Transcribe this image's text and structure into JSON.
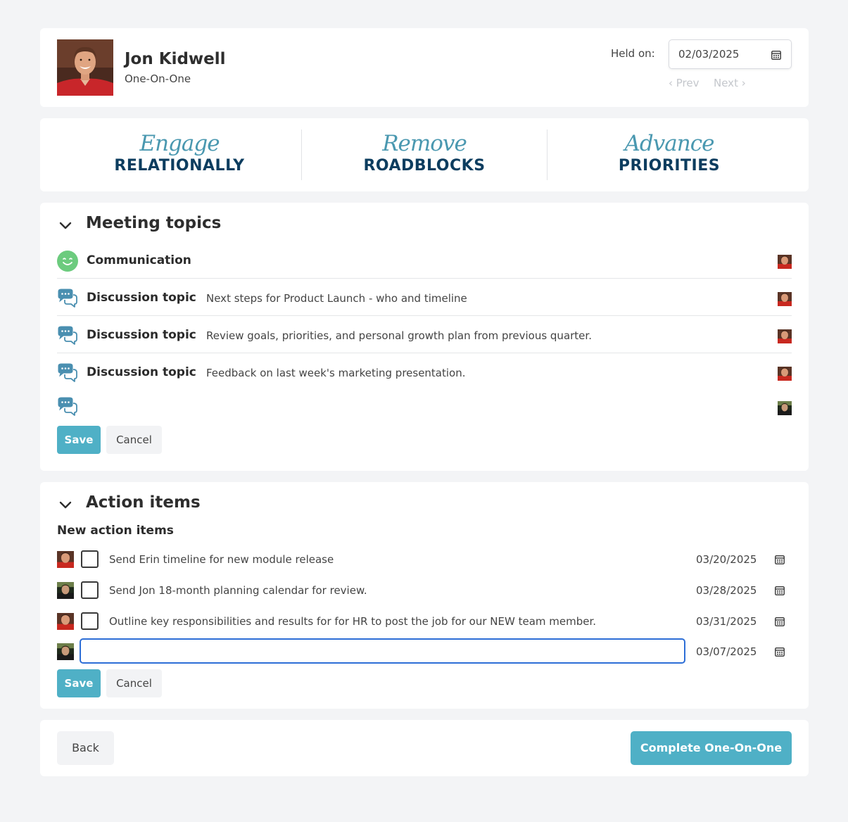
{
  "header": {
    "name": "Jon Kidwell",
    "subtitle": "One-On-One",
    "held_on_label": "Held on:",
    "held_on_date": "02/03/2025",
    "prev_label": "‹ Prev",
    "next_label": "Next ›"
  },
  "pillars": [
    {
      "script": "Engage",
      "word": "RELATIONALLY"
    },
    {
      "script": "Remove",
      "word": "ROADBLOCKS"
    },
    {
      "script": "Advance",
      "word": "PRIORITIES"
    }
  ],
  "topics": {
    "title": "Meeting topics",
    "items": [
      {
        "type": "Communication",
        "text": "",
        "icon": "smiley-icon"
      },
      {
        "type": "Discussion topic",
        "text": "Next steps for Product Launch - who and timeline",
        "icon": "chat-bubbles-icon"
      },
      {
        "type": "Discussion topic",
        "text": "Review goals, priorities, and personal growth plan from previous quarter.",
        "icon": "chat-bubbles-icon"
      },
      {
        "type": "Discussion topic",
        "text": "Feedback on last week's marketing presentation.",
        "icon": "chat-bubbles-icon"
      }
    ],
    "save_label": "Save",
    "cancel_label": "Cancel"
  },
  "actions": {
    "title": "Action items",
    "subtitle": "New action items",
    "items": [
      {
        "text": "Send Erin timeline for new module release",
        "date": "03/20/2025",
        "checked": false
      },
      {
        "text": "Send Jon 18-month planning calendar for review.",
        "date": "03/28/2025",
        "checked": false
      },
      {
        "text": "Outline key responsibilities and results for for HR to post the job for our NEW team member.",
        "date": "03/31/2025",
        "checked": false
      }
    ],
    "new_item": {
      "value": "",
      "date": "03/07/2025"
    },
    "save_label": "Save",
    "cancel_label": "Cancel"
  },
  "footer": {
    "back_label": "Back",
    "complete_label": "Complete One-On-One"
  },
  "colors": {
    "accent": "#4fb0c6",
    "navy": "#0d3d5f",
    "script": "#4a98b0",
    "smiley": "#6ccb7e",
    "focus": "#2d6ed6"
  }
}
